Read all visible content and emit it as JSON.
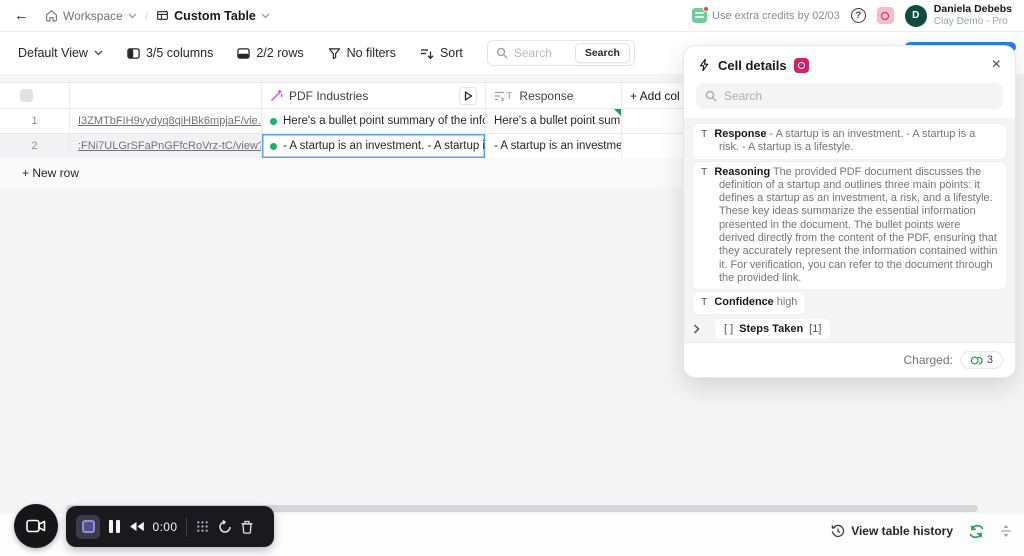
{
  "topbar": {
    "back_glyph": "←",
    "workspace_label": "Workspace",
    "breadcrumb_separator": "/",
    "table_title": "Custom Table",
    "credits_note": "Use extra credits by 02/03",
    "help_glyph": "?",
    "user": {
      "initial": "D",
      "name": "Daniela Debebs",
      "plan": "Clay Demo - Pro"
    }
  },
  "toolbar": {
    "view_selector": "Default View",
    "columns_summary": "3/5 columns",
    "rows_summary": "2/2 rows",
    "filters_summary": "No filters",
    "sort_label": "Sort",
    "search_placeholder": "Search",
    "search_button_label": "Search"
  },
  "table": {
    "header": {
      "pdf_column": "PDF Industries",
      "response_type_glyph": "T",
      "response_column": "Response",
      "add_column": "+ Add col"
    },
    "rows": [
      {
        "num": "1",
        "url": "I3ZMTbFIH9vydyq8qiHBk6mpjaF/vie...",
        "pdf_value": "Here's a bullet point summary of the info...",
        "response_value": "Here's a bullet point sum..."
      },
      {
        "num": "2",
        "url": ":FNi7ULGrSFaPnGFfcRoVrz-tC/view?...",
        "pdf_value": "- A startup is an investment. - A startup i...",
        "response_value": "- A startup is an investme..."
      }
    ],
    "new_row_label": "+ New row"
  },
  "panel": {
    "title": "Cell details",
    "close_glyph": "×",
    "search_placeholder": "Search",
    "response": {
      "type_glyph": "T",
      "label": "Response",
      "value": "- A startup is an investment. - A startup is a risk. - A startup is a lifestyle."
    },
    "reasoning": {
      "type_glyph": "T",
      "label": "Reasoning",
      "value": "The provided PDF document discusses the definition of a startup and outlines three main points: it defines a startup as an investment, a risk, and a lifestyle. These key ideas summarize the essential information presented in the document. The bullet points were derived directly from the content of the PDF, ensuring that they accurately represent the information contained within it. For verification, you can refer to the document through the provided link."
    },
    "confidence": {
      "type_glyph": "T",
      "label": "Confidence",
      "value": "high"
    },
    "steps": {
      "bracket_glyph": "[ ]",
      "label": "Steps Taken",
      "count": "[1]"
    },
    "footer": {
      "charged_label": "Charged:",
      "charged_amount": "3"
    }
  },
  "recorder": {
    "time": "0:00"
  },
  "bottombar": {
    "history_label": "View table history"
  },
  "colors": {
    "accent_blue": "#2b7bf3",
    "success_green": "#12b76a",
    "badge_pink": "#d91f63",
    "selected_cell_blue": "#57a2f7"
  }
}
